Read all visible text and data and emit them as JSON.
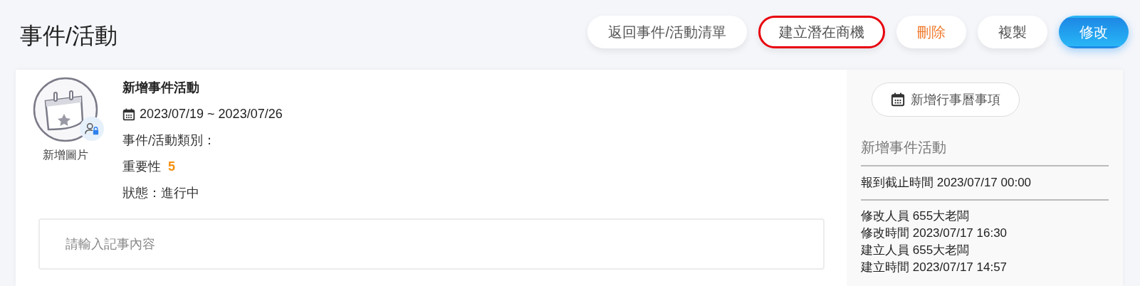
{
  "page_title": "事件/活動",
  "actions": [
    {
      "label": "返回事件/活動清單",
      "kind": "default",
      "highlighted": false
    },
    {
      "label": "建立潛在商機",
      "kind": "default",
      "highlighted": true
    },
    {
      "label": "刪除",
      "kind": "danger",
      "highlighted": false
    },
    {
      "label": "複製",
      "kind": "default",
      "highlighted": false
    },
    {
      "label": "修改",
      "kind": "primary",
      "highlighted": false
    }
  ],
  "avatar": {
    "caption": "新增圖片"
  },
  "event": {
    "name": "新增事件活動",
    "date_range": "2023/07/19 ~ 2023/07/26",
    "category_label": "事件/活動類別：",
    "importance_label": "重要性",
    "importance_value": "5",
    "status": "狀態：進行中"
  },
  "note": {
    "placeholder": "請輸入記事內容"
  },
  "side_panel": {
    "calendar_button": "新增行事曆事項",
    "title": "新增事件活動",
    "deadline": "報到截止時間 2023/07/17 00:00",
    "audit": [
      "修改人員 655大老闆",
      "修改時間 2023/07/17 16:30",
      "建立人員 655大老闆",
      "建立時間 2023/07/17 14:57"
    ]
  }
}
